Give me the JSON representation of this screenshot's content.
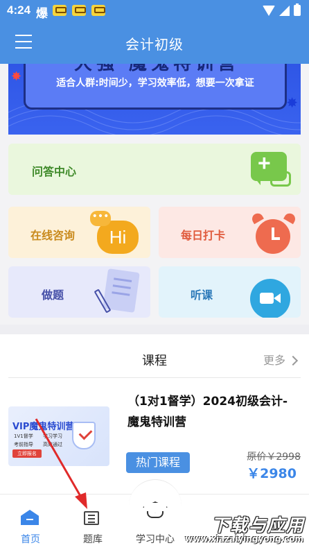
{
  "status_bar": {
    "time": "4:24",
    "extra_text": "爆"
  },
  "header": {
    "title": "会计初级"
  },
  "banner": {
    "headline": "大强 魔鬼特训营",
    "subtitle": "适合人群:时间少，学习效率低，想要一次拿证"
  },
  "tiles": {
    "qa": "问答中心",
    "consult": "在线咨询",
    "consult_icon_text": "Hi",
    "checkin": "每日打卡",
    "exercise": "做题",
    "listen": "听课"
  },
  "course_section": {
    "title": "课程",
    "more": "更多",
    "course": {
      "name": "（1对1督学）2024初级会计-魔鬼特训营",
      "tag": "热门课程",
      "original_price": "原价￥2998",
      "price": "￥2980",
      "thumb": {
        "title": "VIP魔鬼特训营",
        "lines": [
          "1V1督学",
          "学习学习",
          "考前指导",
          "高效通过"
        ],
        "button": "立即报名"
      }
    }
  },
  "bottom_nav": {
    "items": [
      {
        "label": "首页",
        "icon": "home-icon",
        "active": true
      },
      {
        "label": "题库",
        "icon": "question-bank-icon",
        "active": false
      },
      {
        "label": "学习中心",
        "icon": "graduation-cap-icon",
        "active": false
      }
    ]
  },
  "watermark": {
    "text": "下载与应用",
    "url": "www.xiazaiyingyong.com"
  },
  "colors": {
    "primary": "#4a90e2",
    "accent_blue": "#3b86e8",
    "green": "#78c84b",
    "orange": "#f3a91e",
    "red": "#ee6b4f"
  }
}
